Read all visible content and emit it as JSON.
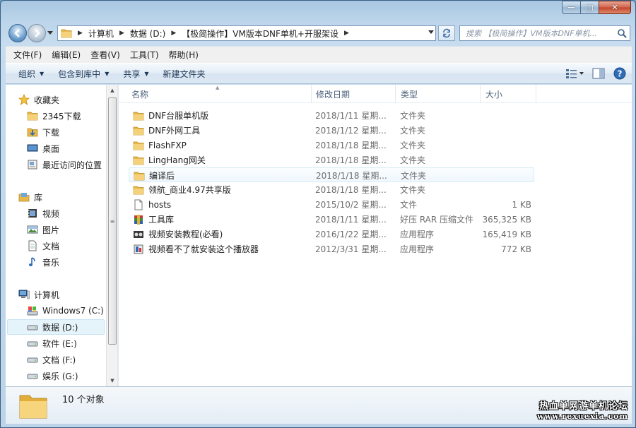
{
  "window": {
    "caption": {
      "min": "—",
      "max": "□",
      "close": "✕"
    }
  },
  "address": {
    "crumbs": [
      "计算机",
      "数据 (D:)",
      "【极简操作】VM版本DNF单机+开服架设"
    ]
  },
  "search": {
    "placeholder": "搜索 【极简操作】VM版本DNF单机..."
  },
  "menu": [
    "文件(F)",
    "编辑(E)",
    "查看(V)",
    "工具(T)",
    "帮助(H)"
  ],
  "commands": {
    "organize": "组织",
    "include_library": "包含到库中",
    "share": "共享",
    "new_folder": "新建文件夹"
  },
  "nav": {
    "favorites_title": "收藏夹",
    "favorites": [
      "2345下载",
      "下载",
      "桌面",
      "最近访问的位置"
    ],
    "libraries_title": "库",
    "libraries": [
      "视频",
      "图片",
      "文档",
      "音乐"
    ],
    "computer_title": "计算机",
    "drives": [
      "Windows7 (C:)",
      "数据 (D:)",
      "软件 (E:)",
      "文档 (F:)",
      "娱乐 (G:)"
    ],
    "selected_drive_index": 1
  },
  "columns": {
    "name": "名称",
    "date": "修改日期",
    "type": "类型",
    "size": "大小"
  },
  "files": [
    {
      "name": "DNF台服单机版",
      "date": "2018/1/11 星期...",
      "type": "文件夹",
      "size": "",
      "icon": "folder-icon"
    },
    {
      "name": "DNF外网工具",
      "date": "2018/1/12 星期...",
      "type": "文件夹",
      "size": "",
      "icon": "folder-icon"
    },
    {
      "name": "FlashFXP",
      "date": "2018/1/18 星期...",
      "type": "文件夹",
      "size": "",
      "icon": "folder-icon"
    },
    {
      "name": "LingHang网关",
      "date": "2018/1/18 星期...",
      "type": "文件夹",
      "size": "",
      "icon": "folder-icon"
    },
    {
      "name": "编译后",
      "date": "2018/1/18 星期...",
      "type": "文件夹",
      "size": "",
      "icon": "folder-icon",
      "hover": true
    },
    {
      "name": "领航_商业4.97共享版",
      "date": "2018/1/18 星期...",
      "type": "文件夹",
      "size": "",
      "icon": "folder-icon"
    },
    {
      "name": "hosts",
      "date": "2015/10/2 星期...",
      "type": "文件",
      "size": "1 KB",
      "icon": "file-icon"
    },
    {
      "name": "工具库",
      "date": "2018/1/11 星期...",
      "type": "好压 RAR 压缩文件",
      "size": "365,325 KB",
      "icon": "rar-archive-icon"
    },
    {
      "name": "视频安装教程(必看)",
      "date": "2016/1/22 星期...",
      "type": "应用程序",
      "size": "165,419 KB",
      "icon": "video-app-icon"
    },
    {
      "name": "视频看不了就安装这个播放器",
      "date": "2012/3/31 星期...",
      "type": "应用程序",
      "size": "772 KB",
      "icon": "installer-app-icon"
    }
  ],
  "status": {
    "count": "10 个对象"
  },
  "watermark": {
    "line1": "热血单网游单机论坛",
    "line2": "www.rexuexia.com"
  }
}
